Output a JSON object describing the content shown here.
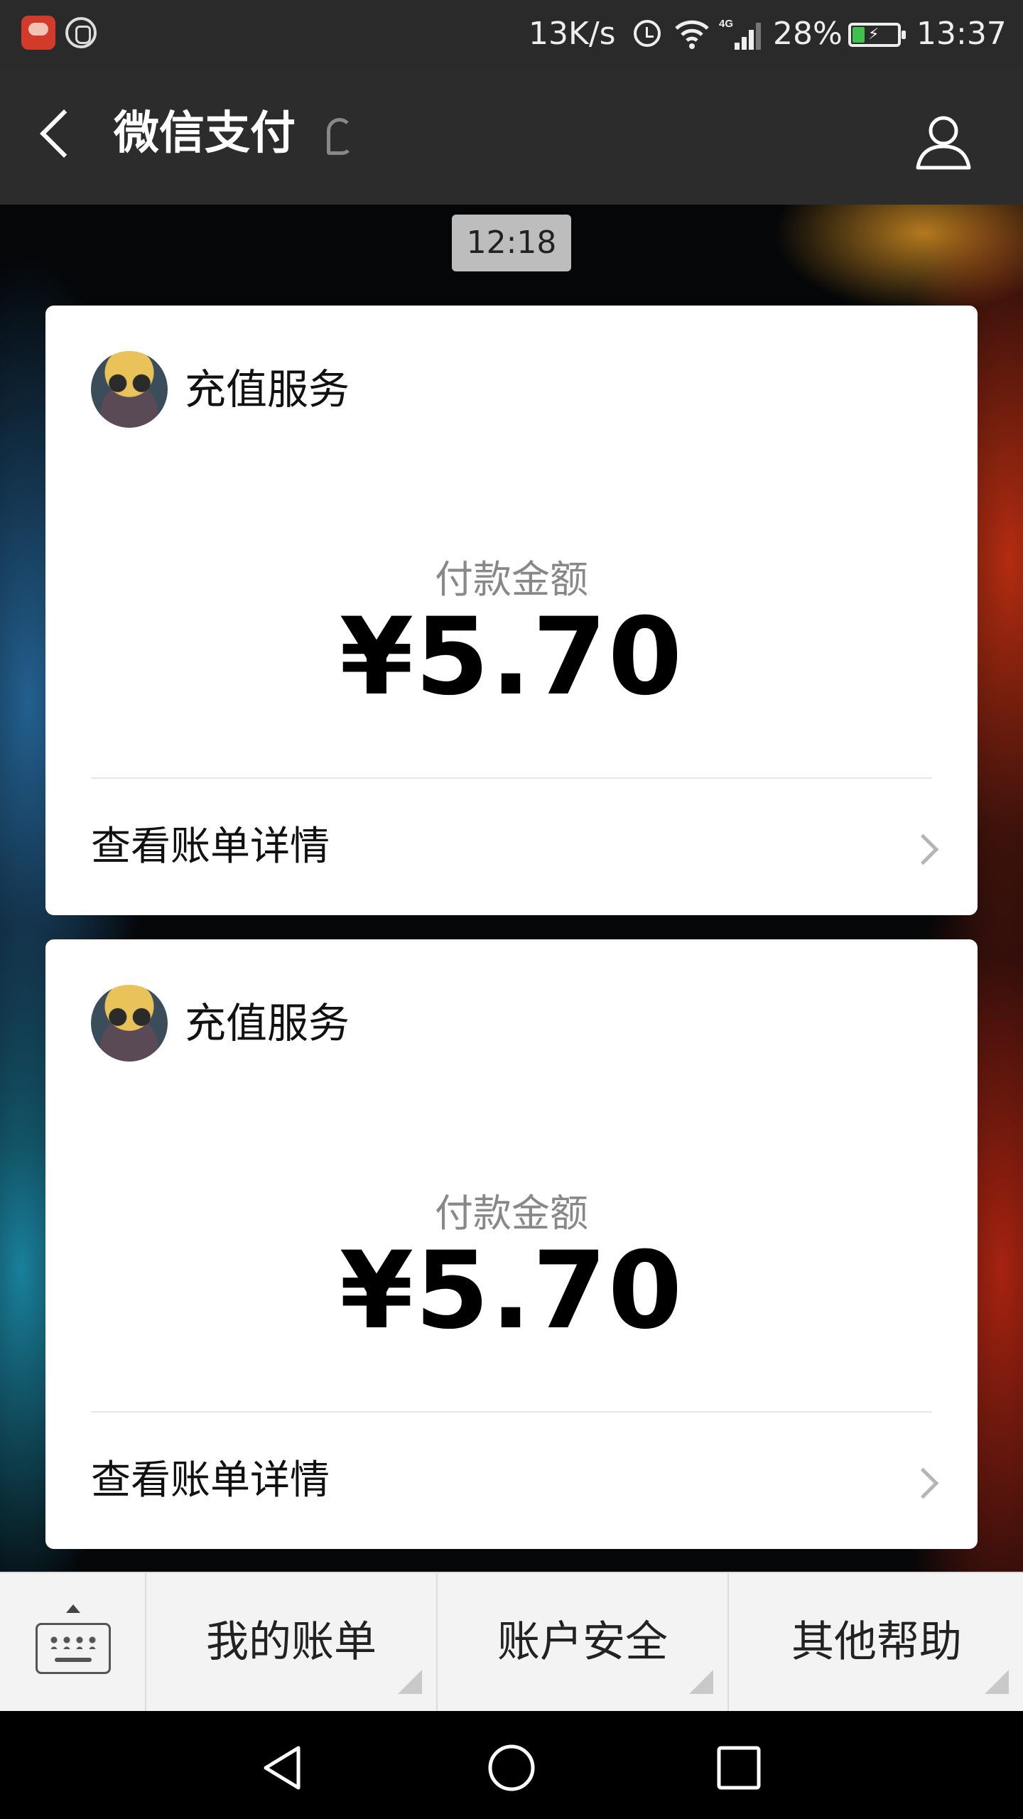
{
  "status_bar": {
    "net_speed": "13K/s",
    "battery_percent": "28%",
    "battery_level": 0.28,
    "time": "13:37",
    "icons": [
      "app-notification-icon",
      "hand-icon",
      "alarm-icon",
      "wifi-icon",
      "4g-signal-icon",
      "battery-charging-icon"
    ]
  },
  "title_bar": {
    "title": "微信支付",
    "back_icon": "chevron-left-icon",
    "ear_icon": "ear-icon",
    "profile_icon": "person-icon"
  },
  "chat": {
    "timestamp": "12:18",
    "cards": [
      {
        "service_name": "充值服务",
        "amount_label": "付款金额",
        "amount": "¥5.70",
        "detail_label": "查看账单详情"
      },
      {
        "service_name": "充值服务",
        "amount_label": "付款金额",
        "amount": "¥5.70",
        "detail_label": "查看账单详情"
      }
    ]
  },
  "menu_bar": {
    "keyboard_icon": "keyboard-icon",
    "items": [
      {
        "label": "我的账单"
      },
      {
        "label": "账户安全"
      },
      {
        "label": "其他帮助"
      }
    ]
  },
  "nav_bar": {
    "icons": [
      "back-triangle-icon",
      "home-circle-icon",
      "recents-square-icon"
    ]
  },
  "colors": {
    "title_bar_bg": "#2c2c2c",
    "card_bg": "#ffffff",
    "amount_label": "#888888",
    "battery_fill": "#3fc24d",
    "menu_bar_bg": "#f3f3f3"
  }
}
